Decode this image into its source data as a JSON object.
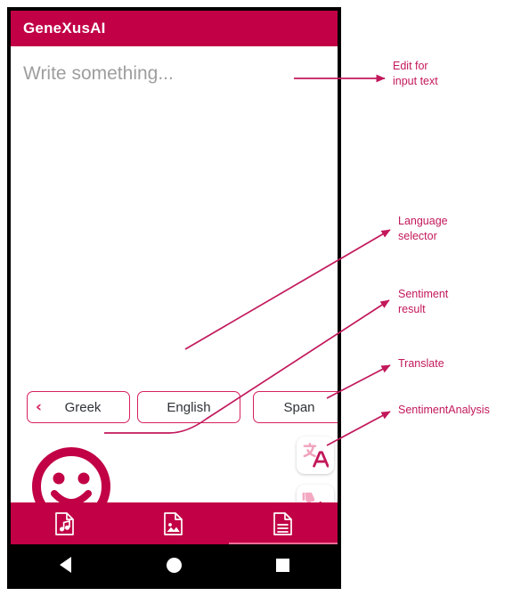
{
  "app": {
    "title": "GeneXusAI",
    "header_color": "#c10045",
    "accent_color": "#d7215c"
  },
  "input": {
    "placeholder": "Write something...",
    "value": ""
  },
  "language_selector": {
    "prev": {
      "label": "Greek",
      "arrow": "‹"
    },
    "current": {
      "label": "English"
    },
    "next": {
      "label": "Span",
      "arrow": "›"
    }
  },
  "sentiment": {
    "icon": "smiley-happy-icon",
    "color": "#c10045"
  },
  "actions": [
    {
      "name": "translate-button",
      "icon": "translate-icon"
    },
    {
      "name": "sentiment-analysis-button",
      "icon": "thumbs-updown-icon"
    }
  ],
  "tabs": [
    {
      "label": "Audio",
      "icon": "audio-file-icon",
      "active": false
    },
    {
      "label": "Image",
      "icon": "image-file-icon",
      "active": false
    },
    {
      "label": "Text",
      "icon": "text-file-icon",
      "active": true
    }
  ],
  "android_nav": {
    "back": "back-triangle-icon",
    "home": "home-circle-icon",
    "recents": "recents-square-icon"
  },
  "annotations": {
    "edit_text": "Edit for\ninput text",
    "language_selector": "Language\nselector",
    "sentiment_result": "Sentiment\nresult",
    "translate": "Translate",
    "sentiment_analysis": "SentimentAnalysis",
    "color": "#c2185b"
  }
}
